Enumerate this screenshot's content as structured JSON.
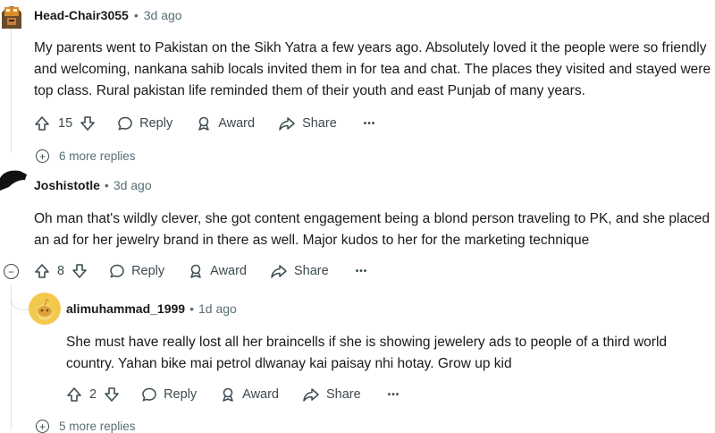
{
  "comments": [
    {
      "author": "Head-Chair3055",
      "time": "3d ago",
      "text": "My parents went to Pakistan on the Sikh Yatra a few years ago. Absolutely loved it the people were so friendly and welcoming, nankana sahib locals invited them in for tea and chat. The places they visited and stayed were top class. Rural pakistan life reminded them of their youth and east Punjab of many years.",
      "votes": "15",
      "reply": "Reply",
      "award": "Award",
      "share": "Share",
      "more": "•••",
      "more_replies": "6 more replies"
    },
    {
      "author": "Joshistotle",
      "time": "3d ago",
      "text": "Oh man that's wildly clever, she got content engagement being a blond person traveling to PK, and she placed an ad for her jewelry brand in there as well. Major kudos to her for the marketing technique",
      "votes": "8",
      "reply": "Reply",
      "award": "Award",
      "share": "Share",
      "more": "•••"
    },
    {
      "author": "alimuhammad_1999",
      "time": "1d ago",
      "text": "She must have really lost all her braincells if she is showing jewelery ads to people of a third world country. Yahan bike mai petrol dlwanay kai paisay nhi hotay. Grow up kid",
      "votes": "2",
      "reply": "Reply",
      "award": "Award",
      "share": "Share",
      "more": "•••",
      "more_replies": "5 more replies"
    }
  ],
  "separator": "•",
  "collapse_symbol": "−",
  "expand_symbol": "+",
  "colors": {
    "accent_avatar": "#f2c94c",
    "meta": "#576f76",
    "thread_line": "#e0e3e5"
  }
}
